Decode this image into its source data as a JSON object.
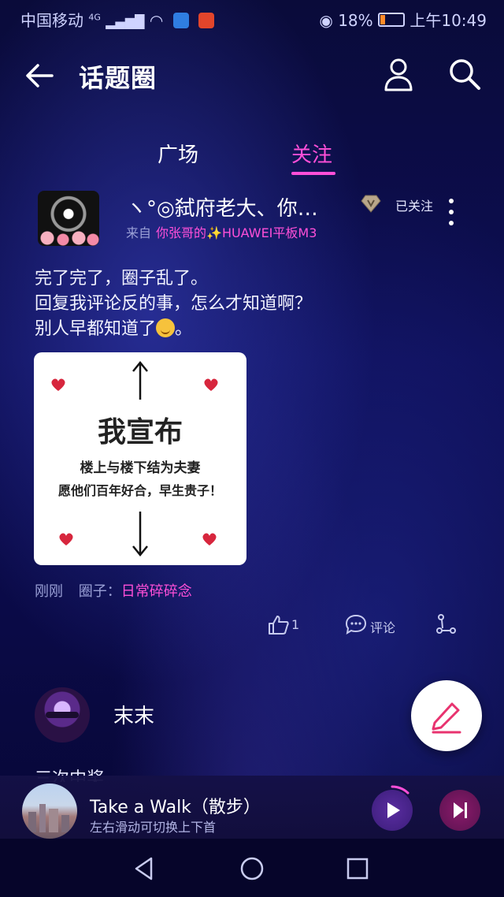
{
  "status_bar": {
    "carrier": "中国移动",
    "network": "4G",
    "battery_percent": "18%",
    "time": "上午10:49"
  },
  "header": {
    "title": "话题圈"
  },
  "tabs": [
    {
      "label": "广场",
      "active": false
    },
    {
      "label": "关注",
      "active": true
    }
  ],
  "post": {
    "username": "ヽ°◎弑府老大、你张...",
    "source_prefix": "来自",
    "source_app": "你张哥的✨HUAWEI平板M3",
    "follow_label": "已关注",
    "text_lines": [
      "完了完了，圈子乱了。",
      "回复我评论反的事，怎么才知道啊？",
      "别人早都知道了"
    ],
    "text_suffix": "。",
    "image": {
      "big_text": "我宣布",
      "line1": "楼上与楼下结为夫妻",
      "line2": "愿他们百年好合，早生贵子！"
    },
    "time": "刚刚",
    "circle_label": "圈子：",
    "circle_name": "日常碎碎念",
    "like_count": "1",
    "comment_label": "评论"
  },
  "post2": {
    "username": "末末",
    "text_clipped": "三次中奖"
  },
  "music": {
    "title": "Take a Walk（散步）",
    "hint": "左右滑动可切换上下首"
  },
  "colors": {
    "accent": "#ff4fd8",
    "background": "#0d0e55"
  }
}
